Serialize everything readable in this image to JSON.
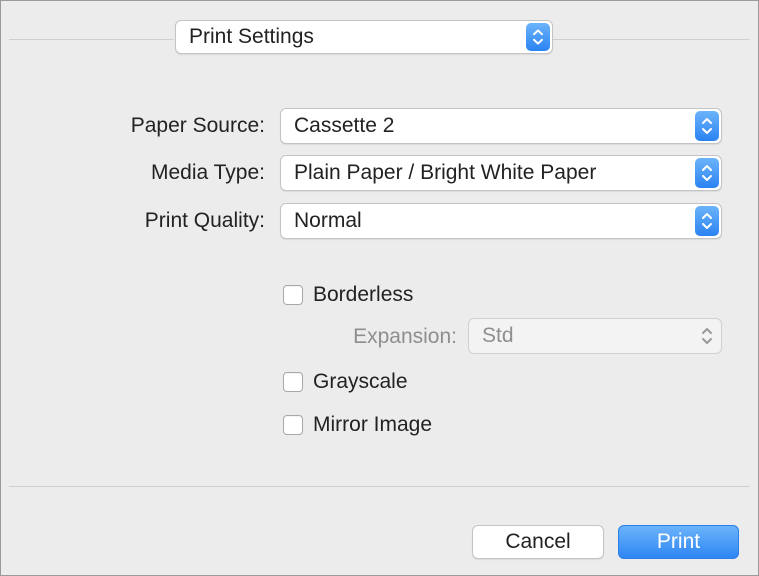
{
  "header": {
    "panel_select": "Print Settings"
  },
  "settings": {
    "paper_source": {
      "label": "Paper Source:",
      "value": "Cassette 2"
    },
    "media_type": {
      "label": "Media Type:",
      "value": "Plain Paper / Bright White Paper"
    },
    "print_quality": {
      "label": "Print Quality:",
      "value": "Normal"
    }
  },
  "options": {
    "borderless": {
      "label": "Borderless",
      "checked": false
    },
    "expansion": {
      "label": "Expansion:",
      "value": "Std",
      "enabled": false
    },
    "grayscale": {
      "label": "Grayscale",
      "checked": false
    },
    "mirror_image": {
      "label": "Mirror Image",
      "checked": false
    }
  },
  "footer": {
    "cancel_label": "Cancel",
    "print_label": "Print"
  },
  "colors": {
    "accent": "#2d86f3",
    "background": "#ececec"
  }
}
